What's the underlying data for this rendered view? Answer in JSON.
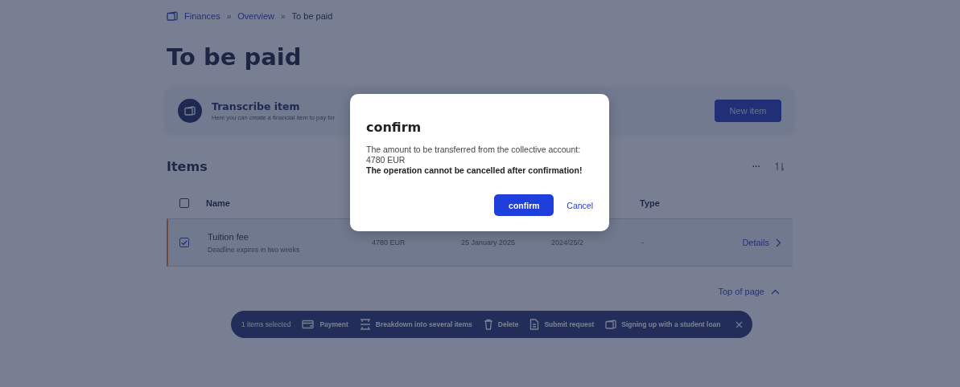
{
  "breadcrumb": [
    {
      "label": "Finances",
      "current": false
    },
    {
      "label": "Overview",
      "current": false
    },
    {
      "label": "To be paid",
      "current": true
    }
  ],
  "breadcrumb_separator": "»",
  "title": "To be paid",
  "create_card": {
    "title": "Transcribe item",
    "description": "Here you can create a financial item to pay for",
    "button": "New item"
  },
  "items_section": {
    "title": "Items",
    "more": "···"
  },
  "table": {
    "header_checked": false,
    "columns": {
      "name": "Name",
      "type": "Type"
    },
    "rows": [
      {
        "selected": true,
        "name": "Tuition fee",
        "note": "Deadline expires in two weeks",
        "amount": "4780 EUR",
        "date": "25 January 2025",
        "period": "2024/25/2",
        "type": "-",
        "action": "Details"
      }
    ]
  },
  "top_link": "Top of page",
  "action_bar": {
    "count": "1 items selected",
    "actions": [
      {
        "kind": "payment",
        "label": "Payment"
      },
      {
        "kind": "split",
        "label": "Breakdown into several items"
      },
      {
        "kind": "delete",
        "label": "Delete"
      },
      {
        "kind": "request",
        "label": "Submit request"
      },
      {
        "kind": "loan",
        "label": "Signing up with a student loan"
      }
    ]
  },
  "dialog": {
    "title": "confirm",
    "message": "The amount to be transferred from the collective account: 4780 EUR",
    "warning": "The operation cannot be cancelled after confirmation!",
    "confirm": "confirm",
    "cancel": "Cancel"
  }
}
